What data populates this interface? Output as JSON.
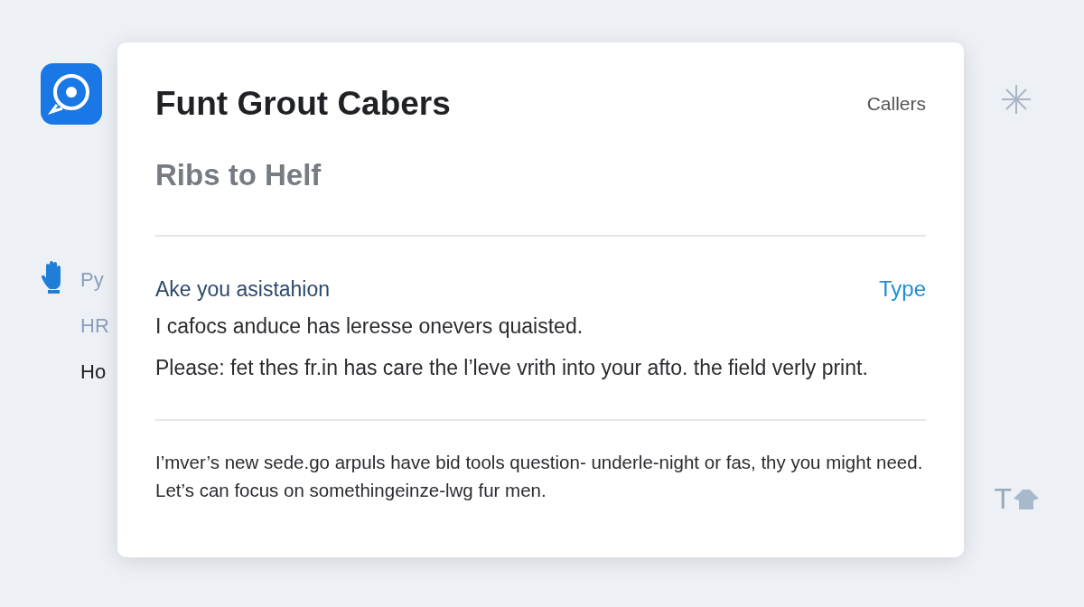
{
  "background": {
    "side_items": [
      {
        "label": "Py",
        "kind": "hand"
      },
      {
        "label": "HR",
        "kind": "none"
      },
      {
        "label": "Ho",
        "kind": "none"
      }
    ],
    "corner_text": "T"
  },
  "dialog": {
    "title": "Funt Grout Cabers",
    "header_link": "Callers",
    "subtitle": "Ribs to Helf",
    "section": {
      "heading": "Ake you asistahion",
      "action": "Type",
      "lines": [
        "I cafocs anduce has leresse onevers quaisted.",
        "Please: fet thes fr.in has care the l’leve vrith into your afto. the field verly print."
      ]
    },
    "footer": "I’mver’s new sede.go arpuls have bid tools question- underle-night or fas, thy you might need. Let’s can focus on somethingeinze-lwg fur men."
  }
}
